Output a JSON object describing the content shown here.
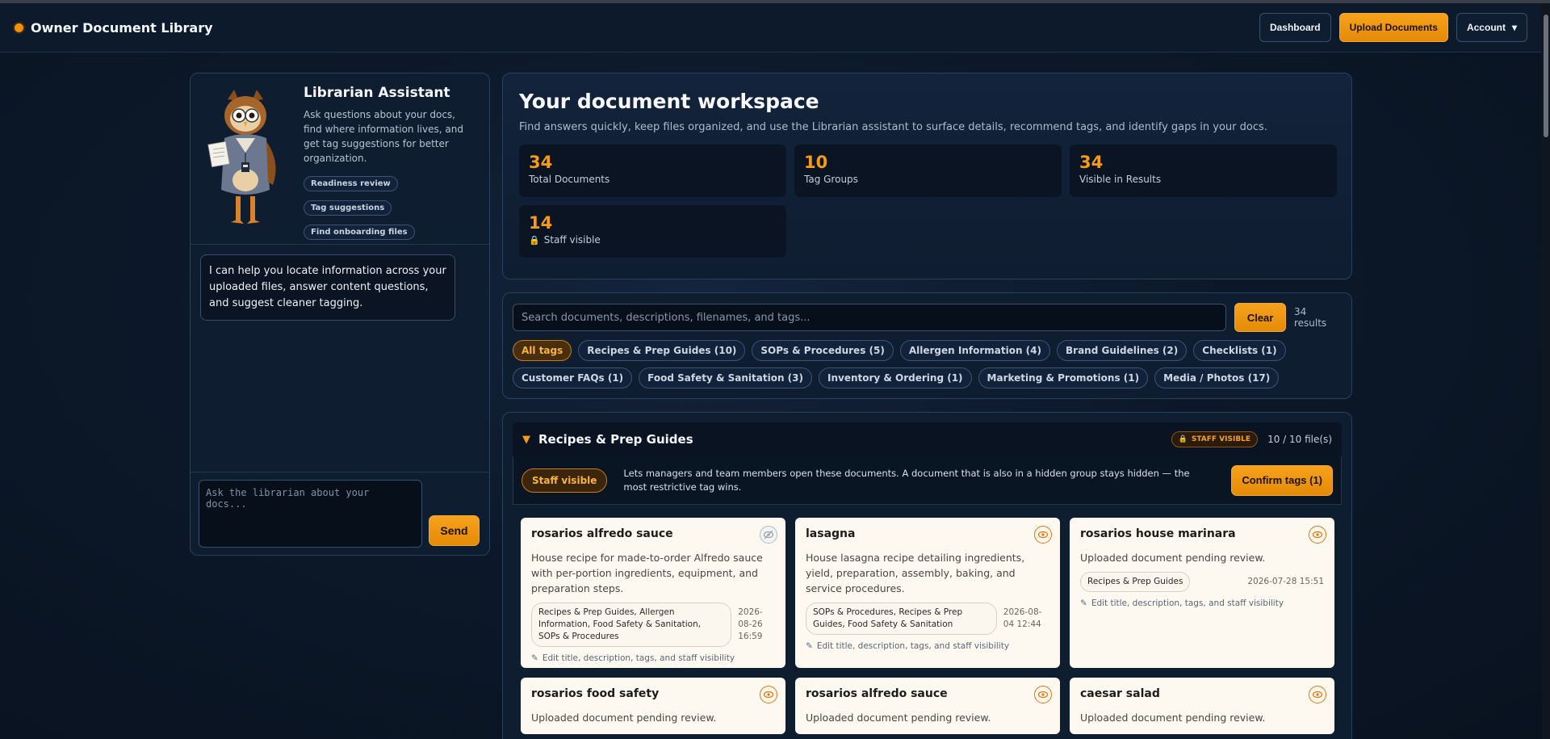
{
  "header": {
    "title": "Owner Document Library",
    "dashboard_label": "Dashboard",
    "upload_label": "Upload Documents",
    "account_label": "Account"
  },
  "assistant": {
    "title": "Librarian Assistant",
    "description": "Ask questions about your docs, find where information lives, and get tag suggestions for better organization.",
    "chips": [
      "Readiness review",
      "Tag suggestions",
      "Find onboarding files"
    ],
    "message": "I can help you locate information across your uploaded files, answer content questions, and suggest cleaner tagging.",
    "input_placeholder": "Ask the librarian about your docs...",
    "send_label": "Send"
  },
  "workspace": {
    "title": "Your document workspace",
    "subtitle": "Find answers quickly, keep files organized, and use the Librarian assistant to surface details, recommend tags, and identify gaps in your docs.",
    "stats": [
      {
        "value": "34",
        "label": "Total Documents"
      },
      {
        "value": "10",
        "label": "Tag Groups"
      },
      {
        "value": "34",
        "label": "Visible in Results"
      },
      {
        "value": "14",
        "label": "Staff visible"
      }
    ]
  },
  "search": {
    "placeholder": "Search documents, descriptions, filenames, and tags...",
    "clear_label": "Clear",
    "results": "34 results",
    "tags": [
      "All tags",
      "Recipes & Prep Guides (10)",
      "SOPs & Procedures (5)",
      "Allergen Information (4)",
      "Brand Guidelines (2)",
      "Checklists (1)",
      "Customer FAQs (1)",
      "Food Safety & Sanitation (3)",
      "Inventory & Ordering (1)",
      "Marketing & Promotions (1)",
      "Media / Photos (17)"
    ]
  },
  "group": {
    "title": "Recipes & Prep Guides",
    "badge": "STAFF VISIBLE",
    "file_count": "10 / 10 file(s)",
    "staff_pill": "Staff visible",
    "bar_text": "Lets managers and team members open these documents. A document that is also in a hidden group stays hidden — the most restrictive tag wins.",
    "confirm_label": "Confirm tags (1)",
    "edit_label": "Edit title, description, tags, and staff visibility",
    "cards": [
      {
        "title": "rosarios alfredo sauce",
        "description": "House recipe for made-to-order Alfredo sauce with per-portion ingredients, equipment, and preparation steps.",
        "tags": "Recipes & Prep Guides, Allergen Information, Food Safety & Sanitation, SOPs & Procedures",
        "date": "2026-08-26 16:59"
      },
      {
        "title": "lasagna",
        "description": "House lasagna recipe detailing ingredients, yield, preparation, assembly, baking, and service procedures.",
        "tags": "SOPs & Procedures, Recipes & Prep Guides, Food Safety & Sanitation",
        "date": "2026-08-04 12:44"
      },
      {
        "title": "rosarios house marinara",
        "description": "Uploaded document pending review.",
        "tags": "Recipes & Prep Guides",
        "date": "2026-07-28 15:51"
      },
      {
        "title": "rosarios food safety",
        "description": "Uploaded document pending review."
      },
      {
        "title": "rosarios alfredo sauce",
        "description": "Uploaded document pending review."
      },
      {
        "title": "caesar salad",
        "description": "Uploaded document pending review."
      }
    ]
  },
  "colors": {
    "accent": "#f59b17",
    "background": "#0c1829",
    "panel": "#0f1d31",
    "card": "#fdf9f0"
  }
}
